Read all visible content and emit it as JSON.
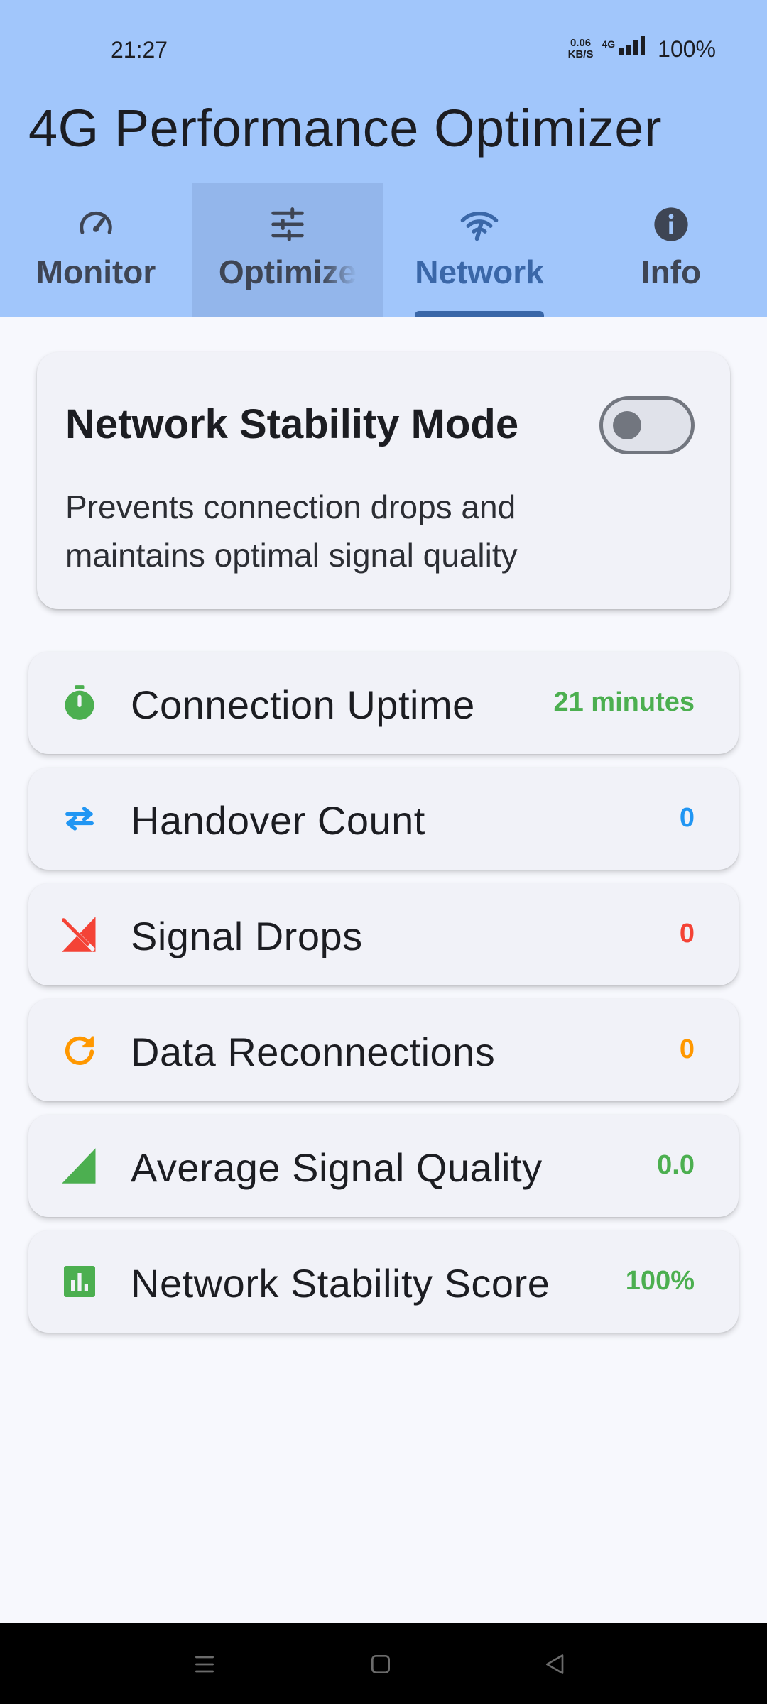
{
  "status_bar": {
    "time": "21:27",
    "net_speed_value": "0.06",
    "net_speed_unit": "KB/S",
    "network_type": "4G",
    "battery": "100%"
  },
  "app": {
    "title": "4G Performance Optimizer"
  },
  "tabs": [
    {
      "label": "Monitor",
      "icon": "speedometer-icon"
    },
    {
      "label": "Optimize",
      "icon": "tune-sliders-icon"
    },
    {
      "label": "Network",
      "icon": "wifi-tethering-icon",
      "active": true
    },
    {
      "label": "Info",
      "icon": "info-icon"
    }
  ],
  "stability_mode": {
    "title": "Network Stability Mode",
    "description": "Prevents connection drops and maintains optimal signal quality",
    "enabled": false
  },
  "stats": [
    {
      "label": "Connection Uptime",
      "value": "21 minutes",
      "icon": "timer-icon",
      "color": "#4caf50"
    },
    {
      "label": "Handover Count",
      "value": "0",
      "icon": "swap-arrows-icon",
      "color": "#2196f3"
    },
    {
      "label": "Signal Drops",
      "value": "0",
      "icon": "signal-off-icon",
      "color": "#f44336"
    },
    {
      "label": "Data Reconnections",
      "value": "0",
      "icon": "refresh-icon",
      "color": "#ff9800"
    },
    {
      "label": "Average Signal Quality",
      "value": "0.0",
      "icon": "signal-cellular-icon",
      "color": "#4caf50"
    },
    {
      "label": "Network Stability Score",
      "value": "100%",
      "icon": "bar-chart-icon",
      "color": "#4caf50"
    }
  ],
  "colors": {
    "header_bg": "#a1c6fb",
    "tab_active": "#3a67a8",
    "page_bg": "#f7f8fd"
  }
}
